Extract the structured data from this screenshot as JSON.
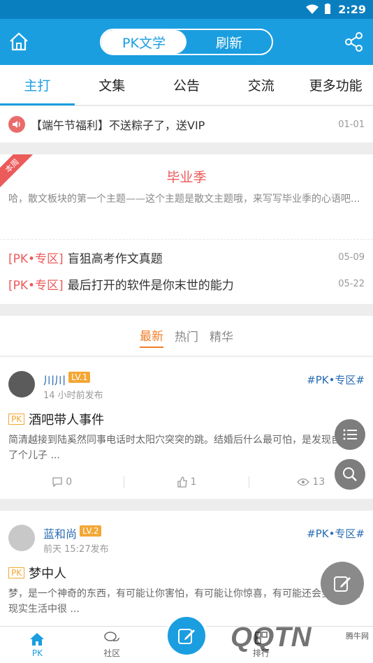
{
  "status_bar": {
    "time": "2:29"
  },
  "app_bar": {
    "segment_active": "PK文学",
    "segment_inactive": "刷新"
  },
  "tabs": [
    {
      "label": "主打",
      "active": true
    },
    {
      "label": "文集",
      "active": false
    },
    {
      "label": "公告",
      "active": false
    },
    {
      "label": "交流",
      "active": false
    },
    {
      "label": "更多功能",
      "active": false
    }
  ],
  "notice": {
    "text": "【端午节福利】不送粽子了，送VIP",
    "date": "01-01"
  },
  "weekly": {
    "ribbon": "本周",
    "title": "毕业季",
    "desc": "哈，散文板块的第一个主题——这个主题是散文主题哦，来写写毕业季的心语吧...",
    "rows": [
      {
        "tag": "[PK•专区]",
        "title": "盲狙高考作文真题",
        "date": "05-09"
      },
      {
        "tag": "[PK•专区]",
        "title": "最后打开的软件是你末世的能力",
        "date": "05-22"
      }
    ]
  },
  "filters": {
    "latest": "最新",
    "hot": "热门",
    "best": "精华"
  },
  "posts": [
    {
      "name": "川川",
      "level": "LV.1",
      "time": "14 小时前发布",
      "zone": "#PK•专区#",
      "pk": "PK",
      "title": "酒吧带人事件",
      "excerpt": "简清越接到陆奚然同事电话时太阳穴突突的跳。结婚后什么最可怕，是发现自己养了个儿子 ...",
      "comments": "0",
      "likes": "1",
      "views": "13"
    },
    {
      "name": "蓝和尚",
      "level": "LV.2",
      "time": "前天 15:27发布",
      "zone": "#PK•专区#",
      "pk": "PK",
      "title": "梦中人",
      "excerpt": "梦，是一个神奇的东西，有可能让你害怕，有可能让你惊喜，有可能还会梦见一些现实生活中很 ..."
    }
  ],
  "bottom_nav": {
    "pk": "PK",
    "community": "社区",
    "rank": "排行"
  },
  "watermark": {
    "main": "QQTN",
    "small": "腾牛网"
  },
  "colors": {
    "primary": "#1a9ee0",
    "red": "#ec5a5a",
    "orange": "#f07d28",
    "level": "#f3a735"
  }
}
